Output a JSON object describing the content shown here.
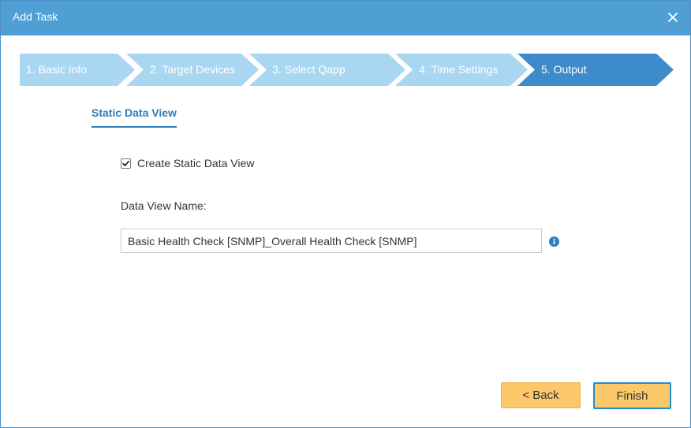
{
  "window": {
    "title": "Add Task",
    "close_icon": "close-icon"
  },
  "steps": [
    {
      "label": "1. Basic Info",
      "active": false
    },
    {
      "label": "2. Target Devices",
      "active": false
    },
    {
      "label": "3. Select Qapp",
      "active": false
    },
    {
      "label": "4. Time Settings",
      "active": false
    },
    {
      "label": "5. Output",
      "active": true
    }
  ],
  "section": {
    "tab_label": "Static Data View"
  },
  "form": {
    "create_view": {
      "label": "Create Static Data View",
      "checked": true
    },
    "name_label": "Data View Name:",
    "name_value": "Basic Health Check [SNMP]_Overall Health Check [SNMP]",
    "info_icon": "info-icon"
  },
  "footer": {
    "back_label": "< Back",
    "finish_label": "Finish"
  },
  "colors": {
    "titlebar": "#509fd4",
    "step_inactive": "#a9d6f1",
    "step_active": "#3d8bcb",
    "accent_text": "#2d7fbc",
    "button": "#fcc86a",
    "focus_border": "#1e8fd6"
  }
}
